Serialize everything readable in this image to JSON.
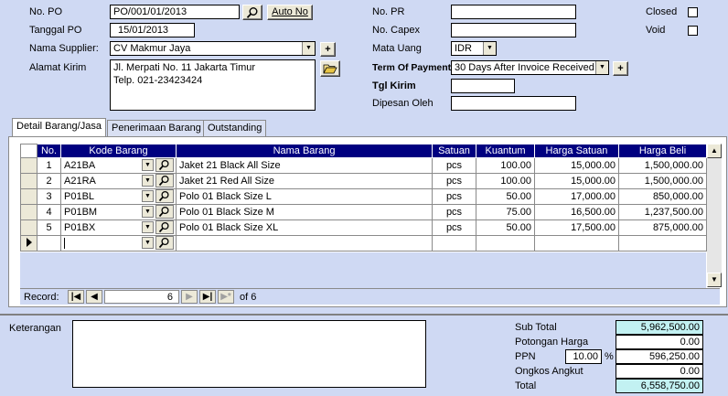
{
  "header": {
    "no_po_label": "No. PO",
    "no_po_value": "PO/001/01/2013",
    "auto_no_label": "Auto No",
    "tanggal_po_label": "Tanggal PO",
    "tanggal_po_value": "15/01/2013",
    "supplier_label": "Nama Supplier:",
    "supplier_value": "CV Makmur Jaya",
    "alamat_label": "Alamat Kirim",
    "alamat_line1": "Jl. Merpati No. 11 Jakarta Timur",
    "alamat_line2": "Telp. 021-23423424",
    "no_pr_label": "No. PR",
    "no_pr_value": "",
    "no_capex_label": "No. Capex",
    "no_capex_value": "",
    "mata_uang_label": "Mata Uang",
    "mata_uang_value": "IDR",
    "term_label": "Term Of Payment",
    "term_value": "30 Days After Invoice Received",
    "tgl_kirim_label": "Tgl Kirim",
    "tgl_kirim_value": "",
    "dipesan_label": "Dipesan Oleh",
    "dipesan_value": "",
    "closed_label": "Closed",
    "void_label": "Void",
    "plus": "+"
  },
  "tabs": [
    {
      "label": "Detail Barang/Jasa",
      "active": true
    },
    {
      "label": "Penerimaan Barang",
      "active": false
    },
    {
      "label": "Outstanding",
      "active": false
    }
  ],
  "grid": {
    "columns": [
      "No.",
      "Kode Barang",
      "Nama Barang",
      "Satuan",
      "Kuantum",
      "Harga Satuan",
      "Harga Beli"
    ],
    "rows": [
      {
        "no": "1",
        "kode": "A21BA",
        "nama": "Jaket 21 Black All Size",
        "satuan": "pcs",
        "kuantum": "100.00",
        "harga_satuan": "15,000.00",
        "harga_beli": "1,500,000.00"
      },
      {
        "no": "2",
        "kode": "A21RA",
        "nama": "Jaket 21 Red All Size",
        "satuan": "pcs",
        "kuantum": "100.00",
        "harga_satuan": "15,000.00",
        "harga_beli": "1,500,000.00"
      },
      {
        "no": "3",
        "kode": "P01BL",
        "nama": "Polo 01 Black Size L",
        "satuan": "pcs",
        "kuantum": "50.00",
        "harga_satuan": "17,000.00",
        "harga_beli": "850,000.00"
      },
      {
        "no": "4",
        "kode": "P01BM",
        "nama": "Polo 01 Black Size M",
        "satuan": "pcs",
        "kuantum": "75.00",
        "harga_satuan": "16,500.00",
        "harga_beli": "1,237,500.00"
      },
      {
        "no": "5",
        "kode": "P01BX",
        "nama": "Polo 01 Black Size XL",
        "satuan": "pcs",
        "kuantum": "50.00",
        "harga_satuan": "17,500.00",
        "harga_beli": "875,000.00"
      }
    ]
  },
  "record_nav": {
    "label": "Record:",
    "current": "6",
    "of_text": "of 6"
  },
  "footer": {
    "keterangan_label": "Keterangan",
    "keterangan_value": "",
    "sub_total_label": "Sub Total",
    "sub_total_value": "5,962,500.00",
    "potongan_label": "Potongan Harga",
    "potongan_value": "0.00",
    "ppn_label": "PPN",
    "ppn_percent": "10.00",
    "percent_sign": "%",
    "ppn_value": "596,250.00",
    "ongkos_label": "Ongkos Angkut",
    "ongkos_value": "0.00",
    "total_label": "Total",
    "total_value": "6,558,750.00"
  }
}
